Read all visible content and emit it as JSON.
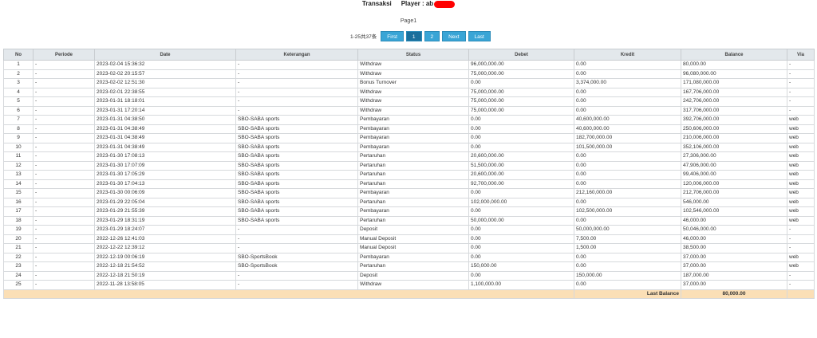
{
  "header": {
    "title": "Transaksi",
    "player_label": "Player : ab"
  },
  "pager": {
    "page_label": "Page1",
    "count": "1-25共37条",
    "buttons": [
      {
        "label": "First",
        "active": false
      },
      {
        "label": "1",
        "active": true
      },
      {
        "label": "2",
        "active": false
      },
      {
        "label": "Next",
        "active": false
      },
      {
        "label": "Last",
        "active": false
      }
    ]
  },
  "table": {
    "headers": [
      "No",
      "Periode",
      "Date",
      "Keterangan",
      "Status",
      "Debet",
      "Kredit",
      "Balance",
      "Via"
    ],
    "rows": [
      {
        "no": "1",
        "periode": "-",
        "date": "2023-02-04 15:36:32",
        "ket": "-",
        "status": "Withdraw",
        "debet": "96,000,000.00",
        "debet_c": "red",
        "kredit": "0.00",
        "kredit_c": "red",
        "balance": "80,000.00",
        "via": "-"
      },
      {
        "no": "2",
        "periode": "-",
        "date": "2023-02-02 20:15:57",
        "ket": "-",
        "status": "Withdraw",
        "debet": "75,000,000.00",
        "debet_c": "red",
        "kredit": "0.00",
        "kredit_c": "red",
        "balance": "96,080,000.00",
        "via": "-"
      },
      {
        "no": "3",
        "periode": "-",
        "date": "2023-02-02 12:51:30",
        "ket": "-",
        "status": "Bonus Turnover",
        "debet": "0.00",
        "debet_c": "",
        "kredit": "3,374,000.00",
        "kredit_c": "",
        "balance": "171,080,000.00",
        "via": "-"
      },
      {
        "no": "4",
        "periode": "-",
        "date": "2023-02-01 22:38:55",
        "ket": "-",
        "status": "Withdraw",
        "debet": "75,000,000.00",
        "debet_c": "red",
        "kredit": "0.00",
        "kredit_c": "red",
        "balance": "167,706,000.00",
        "via": "-"
      },
      {
        "no": "5",
        "periode": "-",
        "date": "2023-01-31 18:18:01",
        "ket": "-",
        "status": "Withdraw",
        "debet": "75,000,000.00",
        "debet_c": "red",
        "kredit": "0.00",
        "kredit_c": "red",
        "balance": "242,706,000.00",
        "via": "-"
      },
      {
        "no": "6",
        "periode": "-",
        "date": "2023-01-31 17:20:14",
        "ket": "-",
        "status": "Withdraw",
        "debet": "75,000,000.00",
        "debet_c": "red",
        "kredit": "0.00",
        "kredit_c": "red",
        "balance": "317,706,000.00",
        "via": "-"
      },
      {
        "no": "7",
        "periode": "-",
        "date": "2023-01-31 04:38:50",
        "ket": "SBO-SABA sports",
        "status": "Pembayaran",
        "debet": "0.00",
        "debet_c": "",
        "kredit": "40,600,000.00",
        "kredit_c": "",
        "balance": "392,706,000.00",
        "via": "web"
      },
      {
        "no": "8",
        "periode": "-",
        "date": "2023-01-31 04:38:49",
        "ket": "SBO-SABA sports",
        "status": "Pembayaran",
        "debet": "0.00",
        "debet_c": "",
        "kredit": "40,600,000.00",
        "kredit_c": "",
        "balance": "250,606,000.00",
        "via": "web"
      },
      {
        "no": "9",
        "periode": "-",
        "date": "2023-01-31 04:38:49",
        "ket": "SBO-SABA sports",
        "status": "Pembayaran",
        "debet": "0.00",
        "debet_c": "",
        "kredit": "182,700,000.00",
        "kredit_c": "",
        "balance": "210,006,000.00",
        "via": "web"
      },
      {
        "no": "10",
        "periode": "-",
        "date": "2023-01-31 04:38:49",
        "ket": "SBO-SABA sports",
        "status": "Pembayaran",
        "debet": "0.00",
        "debet_c": "",
        "kredit": "101,500,000.00",
        "kredit_c": "",
        "balance": "352,106,000.00",
        "via": "web"
      },
      {
        "no": "11",
        "periode": "-",
        "date": "2023-01-30 17:08:13",
        "ket": "SBO-SABA sports",
        "status": "Pertaruhan",
        "debet": "20,600,000.00",
        "debet_c": "",
        "kredit": "0.00",
        "kredit_c": "",
        "balance": "27,306,000.00",
        "via": "web"
      },
      {
        "no": "12",
        "periode": "-",
        "date": "2023-01-30 17:07:09",
        "ket": "SBO-SABA sports",
        "status": "Pertaruhan",
        "debet": "51,500,000.00",
        "debet_c": "",
        "kredit": "0.00",
        "kredit_c": "",
        "balance": "47,906,000.00",
        "via": "web"
      },
      {
        "no": "13",
        "periode": "-",
        "date": "2023-01-30 17:05:29",
        "ket": "SBO-SABA sports",
        "status": "Pertaruhan",
        "debet": "20,600,000.00",
        "debet_c": "",
        "kredit": "0.00",
        "kredit_c": "",
        "balance": "99,406,000.00",
        "via": "web"
      },
      {
        "no": "14",
        "periode": "-",
        "date": "2023-01-30 17:04:13",
        "ket": "SBO-SABA sports",
        "status": "Pertaruhan",
        "debet": "92,700,000.00",
        "debet_c": "",
        "kredit": "0.00",
        "kredit_c": "",
        "balance": "120,006,000.00",
        "via": "web"
      },
      {
        "no": "15",
        "periode": "-",
        "date": "2023-01-30 00:06:09",
        "ket": "SBO-SABA sports",
        "status": "Pembayaran",
        "debet": "0.00",
        "debet_c": "",
        "kredit": "212,160,000.00",
        "kredit_c": "",
        "balance": "212,706,000.00",
        "via": "web"
      },
      {
        "no": "16",
        "periode": "-",
        "date": "2023-01-29 22:05:04",
        "ket": "SBO-SABA sports",
        "status": "Pertaruhan",
        "debet": "102,000,000.00",
        "debet_c": "",
        "kredit": "0.00",
        "kredit_c": "",
        "balance": "546,000.00",
        "via": "web"
      },
      {
        "no": "17",
        "periode": "-",
        "date": "2023-01-29 21:55:39",
        "ket": "SBO-SABA sports",
        "status": "Pembayaran",
        "debet": "0.00",
        "debet_c": "",
        "kredit": "102,500,000.00",
        "kredit_c": "",
        "balance": "102,546,000.00",
        "via": "web"
      },
      {
        "no": "18",
        "periode": "-",
        "date": "2023-01-29 18:31:19",
        "ket": "SBO-SABA sports",
        "status": "Pertaruhan",
        "debet": "50,000,000.00",
        "debet_c": "",
        "kredit": "0.00",
        "kredit_c": "",
        "balance": "46,000.00",
        "via": "web"
      },
      {
        "no": "19",
        "periode": "-",
        "date": "2023-01-29 18:24:07",
        "ket": "-",
        "status": "Deposit",
        "debet": "0.00",
        "debet_c": "green",
        "kredit": "50,000,000.00",
        "kredit_c": "green",
        "balance": "50,046,000.00",
        "via": "-"
      },
      {
        "no": "20",
        "periode": "-",
        "date": "2022-12-26 12:41:03",
        "ket": "-",
        "status": "Manual Deposit",
        "debet": "0.00",
        "debet_c": "green",
        "kredit": "7,500.00",
        "kredit_c": "green",
        "balance": "46,000.00",
        "via": "-"
      },
      {
        "no": "21",
        "periode": "-",
        "date": "2022-12-22 12:39:12",
        "ket": "-",
        "status": "Manual Deposit",
        "debet": "0.00",
        "debet_c": "green",
        "kredit": "1,500.00",
        "kredit_c": "green",
        "balance": "38,500.00",
        "via": "-"
      },
      {
        "no": "22",
        "periode": "-",
        "date": "2022-12-19 00:06:19",
        "ket": "SBO-SportsBook",
        "status": "Pembayaran",
        "debet": "0.00",
        "debet_c": "",
        "kredit": "0.00",
        "kredit_c": "",
        "balance": "37,000.00",
        "via": "web"
      },
      {
        "no": "23",
        "periode": "-",
        "date": "2022-12-18 21:54:52",
        "ket": "SBO-SportsBook",
        "status": "Pertaruhan",
        "debet": "150,000.00",
        "debet_c": "",
        "kredit": "0.00",
        "kredit_c": "",
        "balance": "37,000.00",
        "via": "web"
      },
      {
        "no": "24",
        "periode": "-",
        "date": "2022-12-18 21:50:19",
        "ket": "-",
        "status": "Deposit",
        "debet": "0.00",
        "debet_c": "green",
        "kredit": "150,000.00",
        "kredit_c": "green",
        "balance": "187,000.00",
        "via": "-"
      },
      {
        "no": "25",
        "periode": "-",
        "date": "2022-11-28 13:58:05",
        "ket": "-",
        "status": "Withdraw",
        "debet": "1,100,000.00",
        "debet_c": "red",
        "kredit": "0.00",
        "kredit_c": "red",
        "balance": "37,000.00",
        "via": "-"
      }
    ],
    "footer": {
      "label": "Last Balance",
      "value": "80,000.00"
    }
  }
}
